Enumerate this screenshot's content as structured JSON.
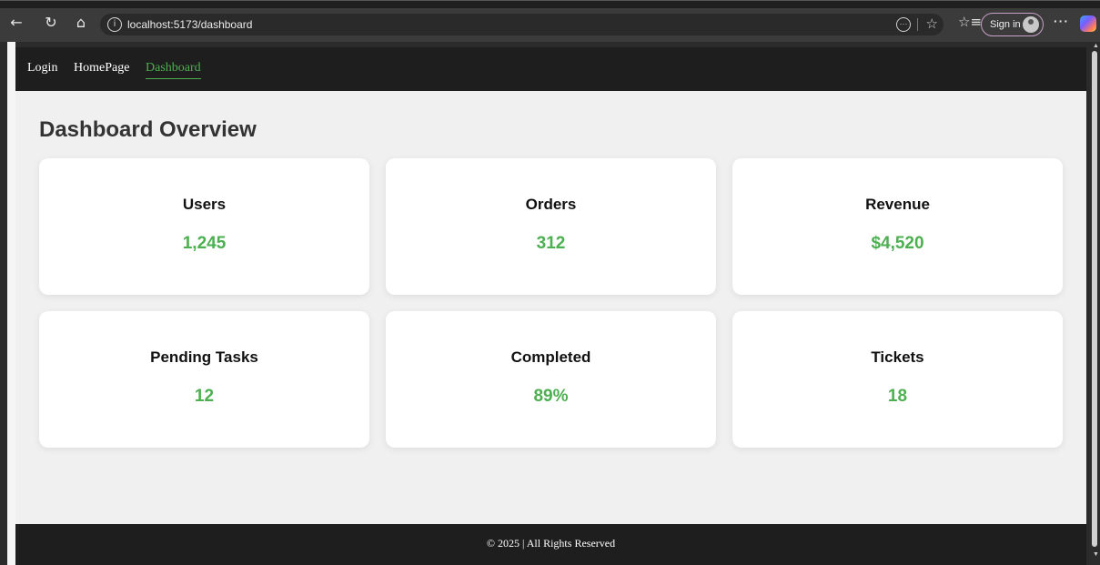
{
  "browser": {
    "url": "localhost:5173/dashboard",
    "sign_in_label": "Sign in",
    "more_label": "···"
  },
  "nav": {
    "items": [
      {
        "label": "Login",
        "active": false
      },
      {
        "label": "HomePage",
        "active": false
      },
      {
        "label": "Dashboard",
        "active": true
      }
    ]
  },
  "main": {
    "title": "Dashboard Overview",
    "cards": [
      {
        "title": "Users",
        "value": "1,245"
      },
      {
        "title": "Orders",
        "value": "312"
      },
      {
        "title": "Revenue",
        "value": "$4,520"
      },
      {
        "title": "Pending Tasks",
        "value": "12"
      },
      {
        "title": "Completed",
        "value": "89%"
      },
      {
        "title": "Tickets",
        "value": "18"
      }
    ]
  },
  "footer": {
    "text": "© 2025 | All Rights Reserved"
  },
  "colors": {
    "accent": "#4caf50",
    "nav_bg": "#1e1e1e",
    "page_bg": "#f0f0f0"
  }
}
